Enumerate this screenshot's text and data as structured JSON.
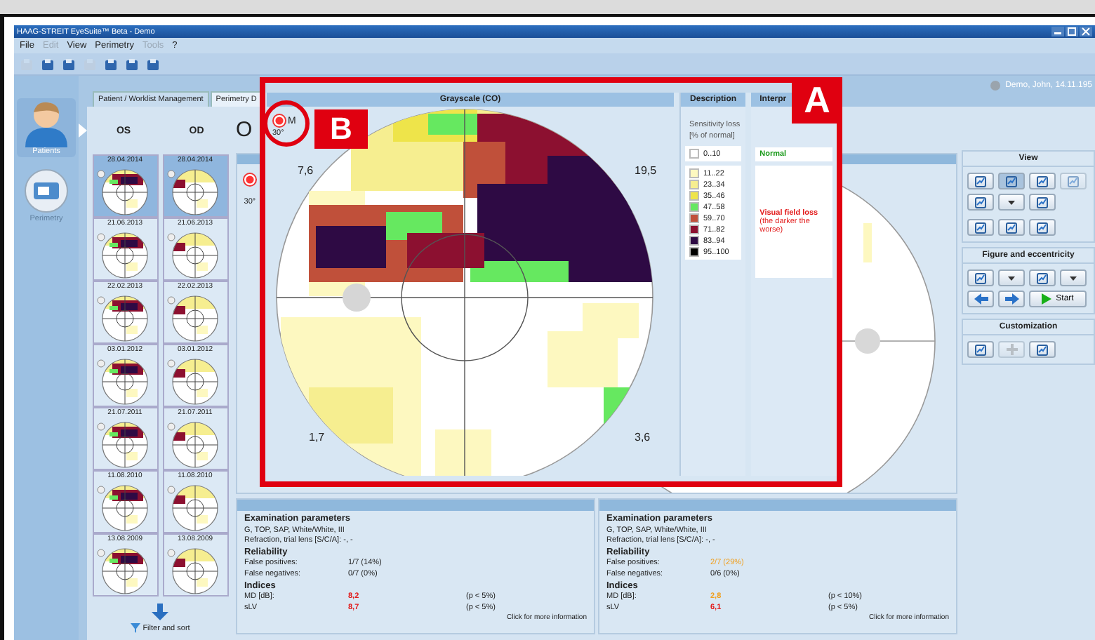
{
  "window": {
    "title": "HAAG-STREIT EyeSuite™ Beta - Demo"
  },
  "menu": [
    {
      "label": "File",
      "disabled": false
    },
    {
      "label": "Edit",
      "disabled": true
    },
    {
      "label": "View",
      "disabled": false
    },
    {
      "label": "Perimetry",
      "disabled": false
    },
    {
      "label": "Tools",
      "disabled": true
    },
    {
      "label": "?",
      "disabled": false
    }
  ],
  "toolbar": [
    {
      "disabled": true
    },
    {
      "disabled": false
    },
    {
      "disabled": false
    },
    {
      "disabled": true
    },
    {
      "disabled": false
    },
    {
      "disabled": false
    },
    {
      "disabled": false
    }
  ],
  "patient": "Demo, John, 14.11.195",
  "nav": [
    {
      "label": "Patients",
      "selected": true
    },
    {
      "label": "Perimetry",
      "selected": false
    }
  ],
  "tabs": [
    {
      "label": "Patient / Worklist Management",
      "selected": false
    },
    {
      "label": "Perimetry D",
      "selected": true
    }
  ],
  "history": {
    "columns": [
      "OS",
      "OD"
    ],
    "rows": [
      {
        "dates": [
          "28.04.2014",
          "28.04.2014"
        ],
        "selected": true
      },
      {
        "dates": [
          "21.06.2013",
          "21.06.2013"
        ],
        "selected": false
      },
      {
        "dates": [
          "22.02.2013",
          "22.02.2013"
        ],
        "selected": false
      },
      {
        "dates": [
          "03.01.2012",
          "03.01.2012"
        ],
        "selected": false
      },
      {
        "dates": [
          "21.07.2011",
          "21.07.2011"
        ],
        "selected": false
      },
      {
        "dates": [
          "11.08.2010",
          "11.08.2010"
        ],
        "selected": false
      },
      {
        "dates": [
          "13.08.2009",
          "13.08.2009"
        ],
        "selected": false
      }
    ],
    "filter": "Filter and sort"
  },
  "eye_title": "O",
  "back_panel": {
    "eccentricity": "30°",
    "selected": true
  },
  "overlay": {
    "label": "A",
    "columns": [
      "Grayscale (CO)",
      "Description",
      "Interpr"
    ],
    "mode": {
      "label": "M",
      "eccentricity": "30°",
      "selected": true
    },
    "callout": "B",
    "quadrants": [
      "7,6",
      "19,5",
      "1,7",
      "3,6"
    ],
    "description": {
      "title": "Sensitivity loss",
      "unit": "[% of normal]",
      "legend": [
        {
          "range": "0..10",
          "color": "#ffffff"
        },
        {
          "range": "11..22",
          "color": "#fdf8c0"
        },
        {
          "range": "23..34",
          "color": "#f6ee90"
        },
        {
          "range": "35..46",
          "color": "#eee44a"
        },
        {
          "range": "47..58",
          "color": "#66e860"
        },
        {
          "range": "59..70",
          "color": "#c0503a"
        },
        {
          "range": "71..82",
          "color": "#8c1030"
        },
        {
          "range": "83..94",
          "color": "#2e0a44"
        },
        {
          "range": "95..100",
          "color": "#000000"
        }
      ]
    },
    "interpretation": [
      {
        "text": "Normal",
        "kind": "normal"
      },
      {
        "text": "Visual field loss",
        "kind": "loss"
      },
      {
        "text": "(the darker the worse)",
        "kind": "loss"
      }
    ]
  },
  "tools": [
    {
      "title": "View",
      "buttons": [
        {
          "kind": "tool",
          "selected": false,
          "disabled": false
        },
        {
          "kind": "tool",
          "selected": true,
          "disabled": false
        },
        {
          "kind": "tool",
          "selected": false,
          "disabled": false
        },
        {
          "kind": "tool",
          "selected": false,
          "disabled": true
        },
        {
          "kind": "tool",
          "selected": false,
          "disabled": false
        },
        {
          "kind": "dropdown",
          "selected": false,
          "disabled": false
        },
        {
          "kind": "tool",
          "selected": false,
          "disabled": false
        },
        {
          "kind": "break"
        },
        {
          "kind": "tool",
          "selected": false,
          "disabled": false
        },
        {
          "kind": "tool",
          "selected": false,
          "disabled": false
        },
        {
          "kind": "tool",
          "selected": false,
          "disabled": false
        }
      ]
    },
    {
      "title": "Figure and eccentricity",
      "buttons": [
        {
          "kind": "tool",
          "selected": false,
          "disabled": false
        },
        {
          "kind": "dropdown",
          "selected": false,
          "disabled": false
        },
        {
          "kind": "tool",
          "selected": false,
          "disabled": false
        },
        {
          "kind": "dropdown",
          "selected": false,
          "disabled": false
        },
        {
          "kind": "back",
          "selected": false,
          "disabled": false
        },
        {
          "kind": "forward",
          "selected": false,
          "disabled": false
        },
        {
          "kind": "start",
          "label": "Start",
          "selected": false,
          "disabled": false
        }
      ]
    },
    {
      "title": "Customization",
      "buttons": [
        {
          "kind": "tool",
          "selected": false,
          "disabled": false
        },
        {
          "kind": "add",
          "selected": false,
          "disabled": true
        },
        {
          "kind": "tool",
          "selected": false,
          "disabled": false
        }
      ]
    }
  ],
  "params": [
    {
      "title": "Examination parameters",
      "program": "G, TOP, SAP, White/White, III",
      "refraction": "Refraction, trial lens [S/C/A]: -, -",
      "reliability": {
        "title": "Reliability",
        "rows": [
          {
            "label": "False positives:",
            "value": "1/7 (14%)",
            "color": "#222222"
          },
          {
            "label": "False negatives:",
            "value": "0/7 (0%)",
            "color": "#222222"
          }
        ]
      },
      "indices": {
        "title": "Indices",
        "rows": [
          {
            "label": "MD [dB]:",
            "value": "8,2",
            "color": "#e21b1b",
            "p": "(p <  5%)"
          },
          {
            "label": "sLV",
            "value": "8,7",
            "color": "#e21b1b",
            "p": "(p <  5%)"
          }
        ]
      },
      "link": "Click for more information"
    },
    {
      "title": "Examination parameters",
      "program": "G, TOP, SAP, White/White, III",
      "refraction": "Refraction, trial lens [S/C/A]: -, -",
      "reliability": {
        "title": "Reliability",
        "rows": [
          {
            "label": "False positives:",
            "value": "2/7 (29%)",
            "color": "#f0a020"
          },
          {
            "label": "False negatives:",
            "value": "0/6 (0%)",
            "color": "#222222"
          }
        ]
      },
      "indices": {
        "title": "Indices",
        "rows": [
          {
            "label": "MD [dB]:",
            "value": "2,8",
            "color": "#f0a020",
            "p": "(p < 10%)"
          },
          {
            "label": "sLV",
            "value": "6,1",
            "color": "#e21b1b",
            "p": "(p <  5%)"
          }
        ]
      },
      "link": "Click for more information"
    }
  ]
}
